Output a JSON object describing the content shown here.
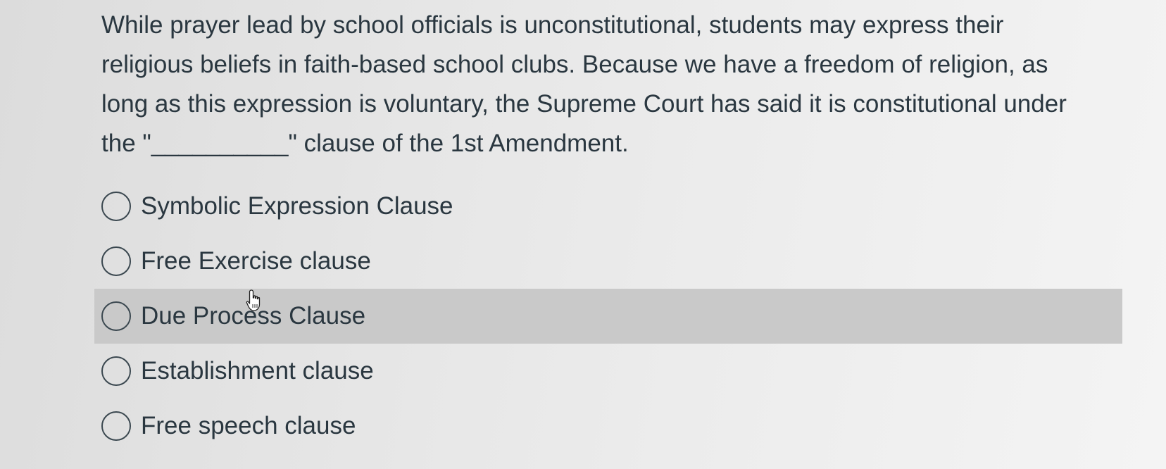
{
  "question": {
    "text": "While prayer lead by school officials is unconstitutional, students may express their religious beliefs in faith-based school clubs. Because we have a freedom of religion, as long as this expression is voluntary, the Supreme Court has said it is constitutional under the \"__________\" clause of the 1st Amendment."
  },
  "answers": [
    {
      "label": "Symbolic Expression Clause",
      "selected": false
    },
    {
      "label": "Free Exercise clause",
      "selected": false
    },
    {
      "label": "Due Process Clause",
      "selected": false,
      "hovered": true
    },
    {
      "label": "Establishment clause",
      "selected": false
    },
    {
      "label": "Free speech clause",
      "selected": false
    }
  ],
  "cursor": {
    "icon": "hand-pointer-icon"
  }
}
